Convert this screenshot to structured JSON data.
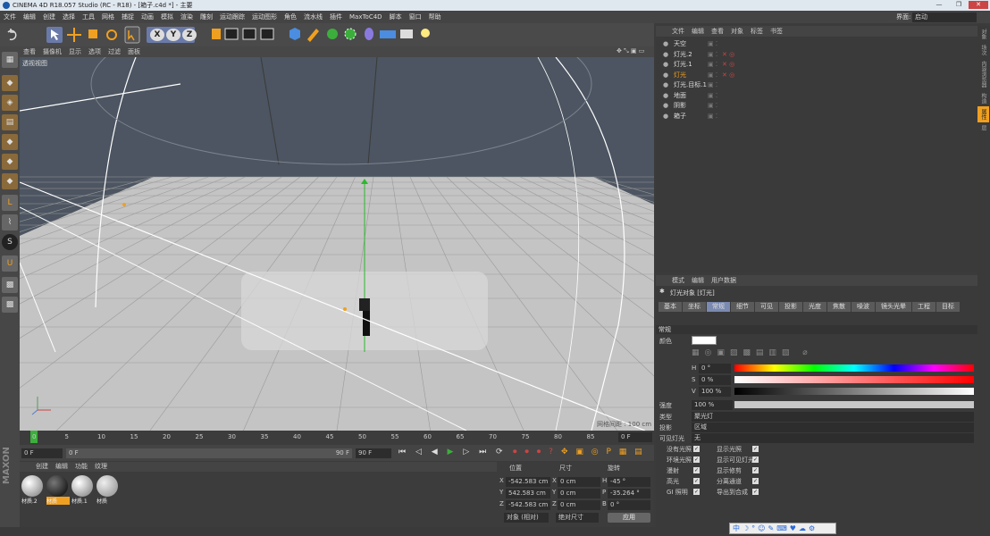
{
  "title": "CINEMA 4D R18.057 Studio (RC - R18) - [箱子.c4d *] - 主要",
  "window_buttons": [
    "—",
    "❐",
    "✕"
  ],
  "menu": [
    "文件",
    "编辑",
    "创建",
    "选择",
    "工具",
    "网格",
    "捕捉",
    "动画",
    "模拟",
    "渲染",
    "雕刻",
    "运动跟踪",
    "运动图形",
    "角色",
    "流水线",
    "插件",
    "MaxToC4D",
    "脚本",
    "窗口",
    "帮助"
  ],
  "layout_label": "界面:",
  "layout_value": "启动",
  "toolbar_icons": [
    "undo-icon",
    "redo-icon",
    "live-select-icon",
    "move-icon",
    "scale-icon",
    "rotate-icon",
    "recent-tool-icon",
    "x-axis-icon",
    "y-axis-icon",
    "z-axis-icon",
    "coord-system-icon",
    "render-view-icon",
    "render-picture-queue-icon",
    "render-settings-icon",
    "cube-icon",
    "pen-icon",
    "subdivision-icon",
    "cloner-icon",
    "deformer-icon",
    "floor-icon",
    "camera-icon",
    "light-icon"
  ],
  "axis_letters": [
    "X",
    "Y",
    "Z"
  ],
  "viewport_menu": [
    "查看",
    "摄像机",
    "显示",
    "选项",
    "过滤",
    "面板"
  ],
  "viewport_label": "透视视图",
  "grid_spacing": "网格间距 : 100 cm",
  "timeline": {
    "ticks": [
      "0",
      "5",
      "10",
      "15",
      "20",
      "25",
      "30",
      "35",
      "40",
      "45",
      "50",
      "55",
      "60",
      "65",
      "70",
      "75",
      "80",
      "85",
      "90"
    ],
    "current_frame": "0 F"
  },
  "transport": {
    "start": "0 F",
    "current": "0 F",
    "end": "90 F",
    "end2": "90 F"
  },
  "materials": {
    "menu": [
      "创建",
      "编辑",
      "功能",
      "纹理"
    ],
    "items": [
      "材质.2",
      "材质",
      "材质.1",
      "材质"
    ]
  },
  "coords": {
    "headers": [
      "位置",
      "尺寸",
      "旋转"
    ],
    "rows": [
      {
        "axis": "X",
        "pos": "-542.583 cm",
        "size_axis": "X",
        "size": "0 cm",
        "rot_axis": "H",
        "rot": "-45 °"
      },
      {
        "axis": "Y",
        "pos": "542.583 cm",
        "size_axis": "Y",
        "size": "0 cm",
        "rot_axis": "P",
        "rot": "-35.264 °"
      },
      {
        "axis": "Z",
        "pos": "-542.583 cm",
        "size_axis": "Z",
        "size": "0 cm",
        "rot_axis": "B",
        "rot": "0 °"
      }
    ],
    "mode1": "对象 (相对)",
    "mode2": "绝对尺寸",
    "apply": "应用"
  },
  "objects": {
    "menu": [
      "文件",
      "编辑",
      "查看",
      "对象",
      "标签",
      "书签"
    ],
    "items": [
      "天空",
      "灯光.2",
      "灯光.1",
      "灯光",
      "灯光.目标.1",
      "地面",
      "阴影",
      "箱子"
    ]
  },
  "right_strip": [
    "对象",
    "场次",
    "内容浏览器",
    "构造",
    "属性",
    "层"
  ],
  "attr": {
    "menu": [
      "模式",
      "编辑",
      "用户数据"
    ],
    "object_title": "灯光对象 [灯光]",
    "tabs": [
      "基本",
      "坐标",
      "常规",
      "细节",
      "可见",
      "投影",
      "光度",
      "焦散",
      "噪波",
      "镜头光晕",
      "工程",
      "目标"
    ],
    "section": "常规",
    "color_label": "颜色",
    "h_label": "H",
    "h_value": "0 °",
    "s_label": "S",
    "s_value": "0 %",
    "v_label": "V",
    "v_value": "100 %",
    "intensity_label": "强度",
    "intensity_value": "100 %",
    "type_label": "类型",
    "type_value": "聚光灯",
    "shadow_label": "投影",
    "shadow_value": "区域",
    "visible_label": "可见灯光",
    "visible_value": "无",
    "options": [
      [
        "没有光照",
        "显示光照"
      ],
      [
        "环境光照",
        "显示可见灯光"
      ],
      [
        "漫射",
        "显示修剪"
      ],
      [
        "高光",
        "分离通道"
      ],
      [
        "GI 照明",
        "导出到合成"
      ]
    ]
  },
  "taskbar_ime": [
    "中",
    "☽",
    "°",
    "☺",
    "✎",
    "⌨",
    "♥",
    "☁",
    "⚙"
  ],
  "colors": {
    "accent": "#f0a020",
    "bg": "#3b3b3b",
    "panel": "#3a3a3a",
    "viewport_sky": "#4c5561",
    "floor": "#c4c4c4"
  }
}
